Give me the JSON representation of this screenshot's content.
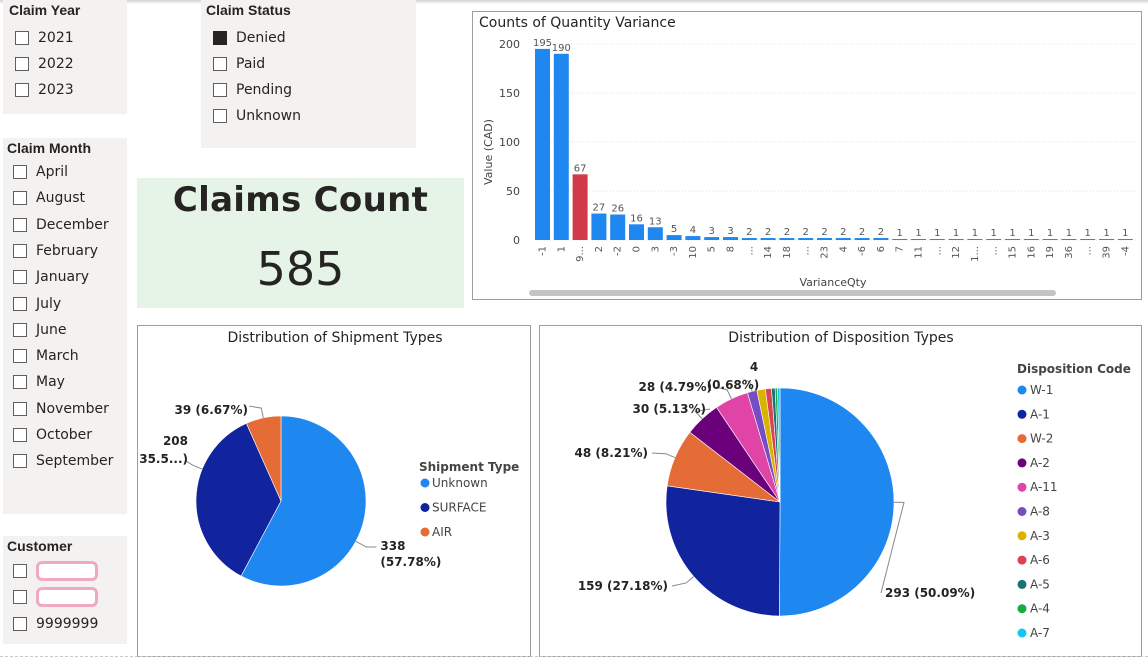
{
  "slicers": {
    "claim_year": {
      "title": "Claim Year",
      "items": [
        "2021",
        "2022",
        "2023"
      ]
    },
    "claim_status": {
      "title": "Claim Status",
      "items": [
        {
          "label": "Denied",
          "checked": true
        },
        {
          "label": "Paid",
          "checked": false
        },
        {
          "label": "Pending",
          "checked": false
        },
        {
          "label": "Unknown",
          "checked": false
        }
      ]
    },
    "claim_month": {
      "title": "Claim Month",
      "items": [
        "April",
        "August",
        "December",
        "February",
        "January",
        "July",
        "June",
        "March",
        "May",
        "November",
        "October",
        "September"
      ]
    },
    "customer": {
      "title": "Customer",
      "items": [
        "",
        "",
        "9999999"
      ]
    }
  },
  "card": {
    "title": "Claims Count",
    "value": "585"
  },
  "bar_chart_title": "Counts of Quantity Variance",
  "shipment_title": "Distribution of Shipment Types",
  "disposition_title": "Distribution of Disposition Types",
  "colors": {
    "primary": "#1e88f0",
    "highlight": "#d13a4b",
    "navy": "#12239e",
    "orange": "#e66c37",
    "card_bg": "#e5f4e6"
  },
  "chart_data": [
    {
      "type": "bar",
      "title": "Counts of Quantity Variance",
      "xlabel": "VarianceQty",
      "ylabel": "Value (CAD)",
      "ylim": [
        0,
        200
      ],
      "yticks": [
        0,
        50,
        100,
        150,
        200
      ],
      "categories": [
        "-1",
        "1",
        "9...",
        "2",
        "-2",
        "0",
        "3",
        "-3",
        "10",
        "5",
        "8",
        "...",
        "14",
        "18",
        "...",
        "23",
        "4",
        "-6",
        "6",
        "7",
        "11",
        "...",
        "12",
        "1...",
        "...",
        "15",
        "16",
        "19",
        "36",
        "...",
        "39",
        "-4"
      ],
      "values": [
        195,
        190,
        67,
        27,
        26,
        16,
        13,
        5,
        4,
        3,
        3,
        2,
        2,
        2,
        2,
        2,
        2,
        2,
        2,
        1,
        1,
        1,
        1,
        1,
        1,
        1,
        1,
        1,
        1,
        1,
        1,
        1
      ],
      "data_labels": [
        "195",
        "190",
        "67",
        "27",
        "26",
        "16",
        "13",
        "5",
        "4",
        "3",
        "3",
        "2",
        "2",
        "2",
        "2",
        "2",
        "2",
        "2",
        "2",
        "1",
        "1",
        "1",
        "1",
        "1",
        "1",
        "1",
        "1",
        "1",
        "1",
        "1",
        "1",
        "1"
      ],
      "highlight_index": 2,
      "grid": true
    },
    {
      "type": "pie",
      "title": "Distribution of Shipment Types",
      "legend_title": "Shipment Type",
      "legend_position": "right",
      "slices": [
        {
          "name": "Unknown",
          "value": 338,
          "label": "338",
          "label2": "(57.78%)",
          "color": "#1e88f0"
        },
        {
          "name": "SURFACE",
          "value": 208,
          "label": "208",
          "label2": "(35.5...)",
          "color": "#12239e"
        },
        {
          "name": "AIR",
          "value": 39,
          "label": "39 (6.67%)",
          "label2": "",
          "color": "#e66c37"
        }
      ]
    },
    {
      "type": "pie",
      "title": "Distribution of Disposition Types",
      "legend_title": "Disposition Code",
      "legend_position": "right",
      "slices": [
        {
          "name": "W-1",
          "value": 293,
          "label": "293 (50.09%)",
          "color": "#1e88f0"
        },
        {
          "name": "A-1",
          "value": 159,
          "label": "159 (27.18%)",
          "color": "#12239e"
        },
        {
          "name": "W-2",
          "value": 48,
          "label": "48 (8.21%)",
          "color": "#e66c37"
        },
        {
          "name": "A-2",
          "value": 30,
          "label": "30 (5.13%)",
          "color": "#6b007b"
        },
        {
          "name": "A-11",
          "value": 28,
          "label": "28 (4.79%)",
          "color": "#e044a7"
        },
        {
          "name": "A-8",
          "value": 8,
          "label": "",
          "color": "#744ec2"
        },
        {
          "name": "A-3",
          "value": 7,
          "label": "",
          "color": "#d9b300"
        },
        {
          "name": "A-6",
          "value": 5,
          "label": "",
          "color": "#d64550"
        },
        {
          "name": "A-5",
          "value": 3,
          "label": "",
          "color": "#197278"
        },
        {
          "name": "A-4",
          "value": 2,
          "label": "",
          "color": "#1aab40"
        },
        {
          "name": "A-7",
          "value": 2,
          "label": "",
          "color": "#15c6f4"
        }
      ],
      "extra_labels": [
        "4",
        "(0.68%)"
      ]
    }
  ]
}
